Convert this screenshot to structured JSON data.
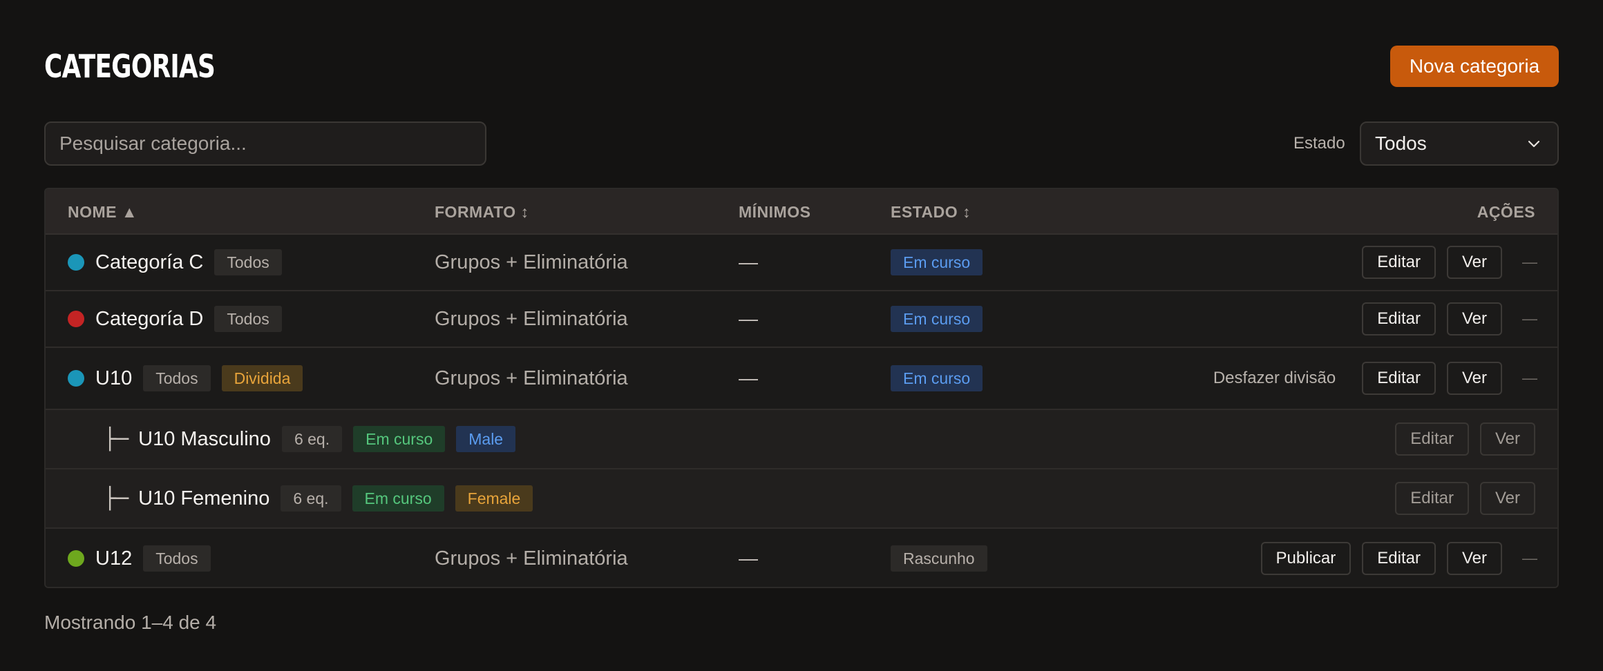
{
  "header": {
    "title": "CATEGORIAS",
    "new_button": "Nova categoria"
  },
  "toolbar": {
    "search_placeholder": "Pesquisar categoria...",
    "filter_label": "Estado",
    "filter_value": "Todos"
  },
  "table": {
    "columns": {
      "nome": "NOME ▲",
      "formato": "FORMATO ↕",
      "minimos": "MÍNIMOS",
      "estado": "ESTADO ↕",
      "acoes": "AÇÕES"
    },
    "rows": [
      {
        "dot_color": "#1b96b8",
        "name": "Categoría C",
        "tags": [
          "Todos"
        ],
        "format": "Grupos + Eliminatória",
        "minimos": "—",
        "status": "Em curso",
        "actions": [
          "Editar",
          "Ver"
        ],
        "more": "—"
      },
      {
        "dot_color": "#c42424",
        "name": "Categoría D",
        "tags": [
          "Todos"
        ],
        "format": "Grupos + Eliminatória",
        "minimos": "—",
        "status": "Em curso",
        "actions": [
          "Editar",
          "Ver"
        ],
        "more": "—"
      },
      {
        "dot_color": "#1b96b8",
        "name": "U10",
        "tags": [
          "Todos",
          "Dividida"
        ],
        "format": "Grupos + Eliminatória",
        "minimos": "—",
        "status": "Em curso",
        "extra_action": "Desfazer divisão",
        "actions": [
          "Editar",
          "Ver"
        ],
        "more": "—"
      },
      {
        "branch": "├─",
        "name": "U10 Masculino",
        "teams": "6 eq.",
        "status": "Em curso",
        "gender": "Male",
        "actions": [
          "Editar",
          "Ver"
        ]
      },
      {
        "branch": "├─",
        "name": "U10 Femenino",
        "teams": "6 eq.",
        "status": "Em curso",
        "gender": "Female",
        "actions": [
          "Editar",
          "Ver"
        ]
      },
      {
        "dot_color": "#6ea81e",
        "name": "U12",
        "tags": [
          "Todos"
        ],
        "format": "Grupos + Eliminatória",
        "minimos": "—",
        "status": "Rascunho",
        "actions": [
          "Publicar",
          "Editar",
          "Ver"
        ],
        "more": "—"
      }
    ]
  },
  "footer": {
    "summary": "Mostrando 1–4 de 4"
  }
}
